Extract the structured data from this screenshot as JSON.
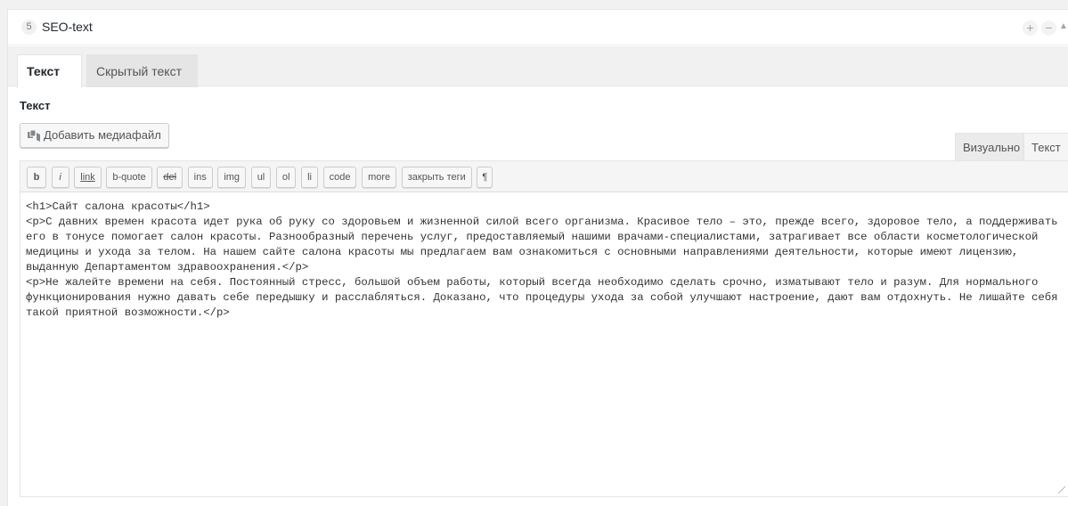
{
  "box": {
    "number": "5",
    "title": "SEO-text",
    "plus": "+",
    "minus": "−",
    "arrow": "▲"
  },
  "tabs": [
    {
      "label": "Текст",
      "active": true
    },
    {
      "label": "Скрытый текст",
      "active": false
    }
  ],
  "field_label": "Текст",
  "media_button": {
    "icon": "media-icon",
    "label": "Добавить медиафайл"
  },
  "mode_tabs": {
    "visual": "Визуально",
    "text": "Текст"
  },
  "quicktags": [
    "b",
    "i",
    "link",
    "b-quote",
    "del",
    "ins",
    "img",
    "ul",
    "ol",
    "li",
    "code",
    "more",
    "закрыть теги",
    "¶"
  ],
  "editor_content": "<h1>Сайт салона красоты</h1>\n<p>С давних времен красота идет рука об руку со здоровьем и жизненной силой всего организма. Красивое тело – это, прежде всего, здоровое тело, а поддерживать его в тонусе помогает салон красоты. Разнообразный перечень услуг, предоставляемый нашими врачами-специалистами, затрагивает все области косметологической медицины и ухода за телом. На нашем сайте салона красоты мы предлагаем вам ознакомиться с основными направлениями деятельности, которые имеют лицензию, выданную Департаментом здравоохранения.</p>\n<p>Не жалейте времени на себя. Постоянный стресс, большой объем работы, который всегда необходимо сделать срочно, изматывают тело и разум. Для нормального функционирования нужно давать себе передышку и расслабляться. Доказано, что процедуры ухода за собой улучшают настроение, дают вам отдохнуть. Не лишайте себя такой приятной возможности.</p>"
}
